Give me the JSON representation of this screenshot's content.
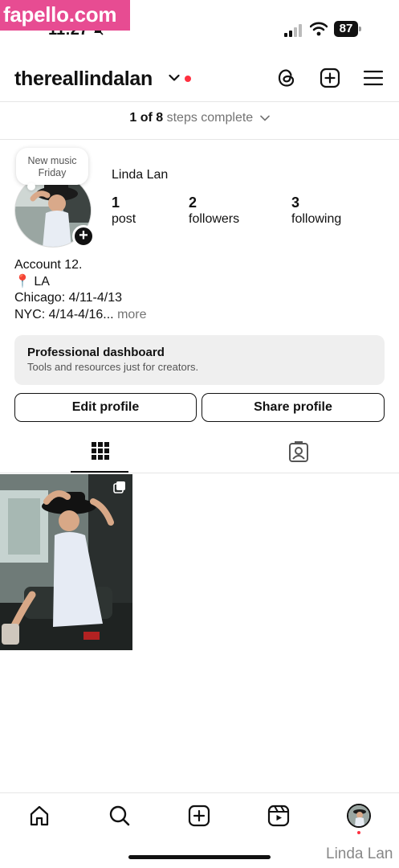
{
  "watermark": "fapello.com",
  "status_bar": {
    "time": "11:27",
    "battery": "87",
    "icons": [
      "bell-slash-icon",
      "signal-icon",
      "wifi-icon",
      "battery-icon"
    ]
  },
  "header": {
    "username": "thereallindalan",
    "icons": [
      "chevron-down-icon",
      "threads-icon",
      "create-post-icon",
      "menu-icon"
    ]
  },
  "steps": {
    "count": "1 of 8",
    "label": "steps complete"
  },
  "profile": {
    "note_line1": "New music",
    "note_line2": "Friday",
    "display_name": "Linda Lan",
    "stats": {
      "posts_num": "1",
      "posts_label": "post",
      "followers_num": "2",
      "followers_label": "followers",
      "following_num": "3",
      "following_label": "following"
    },
    "bio_line1": "Account 12.",
    "bio_line2": "📍 LA",
    "bio_line3": "Chicago: 4/11-4/13",
    "bio_line4": "NYC: 4/14-4/16...",
    "bio_more": "more"
  },
  "professional_dashboard": {
    "title": "Professional dashboard",
    "subtitle": "Tools and resources just for creators."
  },
  "buttons": {
    "edit_profile": "Edit profile",
    "share_profile": "Share profile"
  },
  "tabs": [
    "grid-icon",
    "tagged-icon"
  ],
  "posts_grid": {
    "count": 1
  },
  "bottom_nav": [
    "home-icon",
    "search-icon",
    "create-icon",
    "reels-icon",
    "profile-avatar"
  ],
  "caption_watermark": "Linda Lan",
  "colors": {
    "accent_red": "#ff3040",
    "muted_text": "#737373",
    "card_bg": "#efefef",
    "watermark_pink": "#e74c92"
  }
}
